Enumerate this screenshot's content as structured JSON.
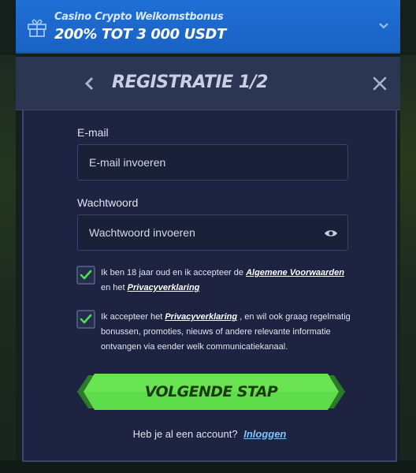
{
  "bonus_banner": {
    "subtitle": "Casino Crypto Welkomstbonus",
    "title": "200% TOT 3 000 USDT",
    "icon": "gift-icon"
  },
  "header": {
    "title": "REGISTRATIE 1/2",
    "back_icon": "chevron-left-icon",
    "close_icon": "close-icon"
  },
  "form": {
    "email": {
      "label": "E-mail",
      "placeholder": "E-mail invoeren"
    },
    "password": {
      "label": "Wachtwoord",
      "placeholder": "Wachtwoord invoeren",
      "icon": "eye-icon"
    },
    "consent_terms": {
      "checked": true,
      "text_before": "Ik ben 18 jaar oud en ik accepteer de",
      "link_terms": "Algemene Voorwaarden",
      "text_middle": "en het",
      "link_privacy": "Privacyverklaring"
    },
    "consent_marketing": {
      "checked": true,
      "text_before": "Ik accepteer het",
      "link_privacy": "Privacyverklaring",
      "text_after": ", en wil ook graag regelmatig bonussen, promoties, nieuws of andere relevante informatie ontvangen via eender welk communicatiekanaal."
    },
    "next_button": "VOLGENDE STAP",
    "login_prompt": "Heb je al een account?",
    "login_link": "Inloggen"
  },
  "colors": {
    "banner": "#1f6fd6",
    "header": "#2c3653",
    "card": "#1d2340",
    "cta": "#5fdc4a",
    "checkmark": "#4fe04a",
    "link": "#7ec4ff"
  }
}
